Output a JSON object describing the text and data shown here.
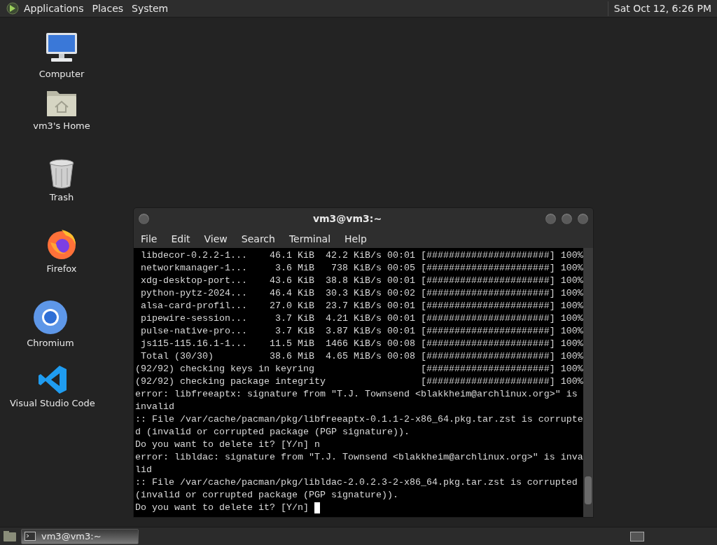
{
  "top_panel": {
    "menus": [
      "Applications",
      "Places",
      "System"
    ],
    "clock": "Sat Oct 12, 6:26 PM"
  },
  "desktop_icons": [
    {
      "label": "Computer",
      "kind": "computer"
    },
    {
      "label": "vm3's Home",
      "kind": "home"
    },
    {
      "label": "Trash",
      "kind": "trash"
    },
    {
      "label": "Firefox",
      "kind": "firefox"
    },
    {
      "label": "Chromium",
      "kind": "chromium"
    },
    {
      "label": "Visual Studio Code",
      "kind": "vscode"
    }
  ],
  "terminal": {
    "title": "vm3@vm3:~",
    "menu": [
      "File",
      "Edit",
      "View",
      "Search",
      "Terminal",
      "Help"
    ],
    "lines": [
      " libdecor-0.2.2-1...    46.1 KiB  42.2 KiB/s 00:01 [######################] 100%",
      " networkmanager-1...     3.6 MiB   738 KiB/s 00:05 [######################] 100%",
      " xdg-desktop-port...    43.6 KiB  38.8 KiB/s 00:01 [######################] 100%",
      " python-pytz-2024...    46.4 KiB  30.3 KiB/s 00:02 [######################] 100%",
      " alsa-card-profil...    27.0 KiB  23.7 KiB/s 00:01 [######################] 100%",
      " pipewire-session...     3.7 KiB  4.21 KiB/s 00:01 [######################] 100%",
      " pulse-native-pro...     3.7 KiB  3.87 KiB/s 00:01 [######################] 100%",
      " js115-115.16.1-1...    11.5 MiB  1466 KiB/s 00:08 [######################] 100%",
      " Total (30/30)          38.6 MiB  4.65 MiB/s 00:08 [######################] 100%",
      "(92/92) checking keys in keyring                   [######################] 100%",
      "(92/92) checking package integrity                 [######################] 100%",
      "error: libfreeaptx: signature from \"T.J. Townsend <blakkheim@archlinux.org>\" is",
      "invalid",
      ":: File /var/cache/pacman/pkg/libfreeaptx-0.1.1-2-x86_64.pkg.tar.zst is corrupte",
      "d (invalid or corrupted package (PGP signature)).",
      "Do you want to delete it? [Y/n] n",
      "error: libldac: signature from \"T.J. Townsend <blakkheim@archlinux.org>\" is inva",
      "lid",
      ":: File /var/cache/pacman/pkg/libldac-2.0.2.3-2-x86_64.pkg.tar.zst is corrupted",
      "(invalid or corrupted package (PGP signature)).",
      "Do you want to delete it? [Y/n] "
    ]
  },
  "bottom_panel": {
    "tasks": [
      {
        "label": "vm3@vm3:~",
        "selected": true
      }
    ]
  }
}
